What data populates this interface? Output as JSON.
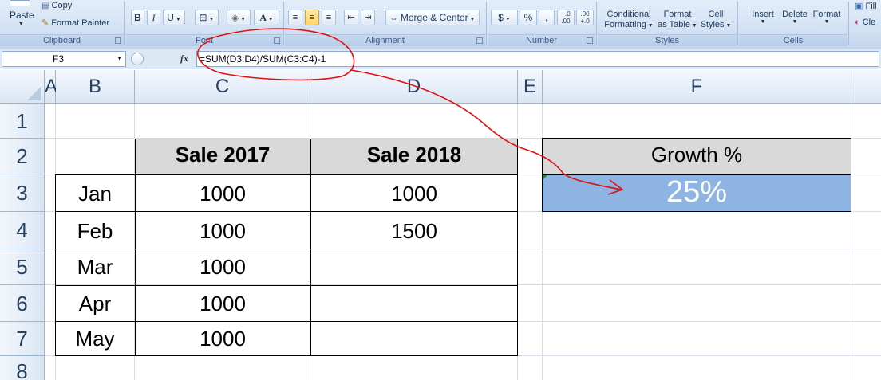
{
  "ribbon": {
    "clipboard": {
      "paste": "Paste",
      "copy": "Copy",
      "format_painter": "Format Painter",
      "label": "Clipboard"
    },
    "font": {
      "label": "Font",
      "bold": "B",
      "italic": "I",
      "underline": "U",
      "font_color": "A"
    },
    "alignment": {
      "label": "Alignment",
      "merge_center": "Merge & Center"
    },
    "number": {
      "label": "Number",
      "currency": "$",
      "percent": "%",
      "comma": ",",
      "inc_decimal": "+.0 .00",
      "dec_decimal": ".00 +.0"
    },
    "styles": {
      "label": "Styles",
      "conditional": "Conditional",
      "formatting": "Formatting",
      "format": "Format",
      "as_table": "as Table",
      "cell": "Cell",
      "styles": "Styles"
    },
    "cells": {
      "label": "Cells",
      "insert": "Insert",
      "delete": "Delete",
      "format": "Format"
    },
    "editing": {
      "fill": "Fill",
      "clear": "Cle"
    }
  },
  "formula_bar": {
    "name_box": "F3",
    "fx": "fx",
    "formula": "=SUM(D3:D4)/SUM(C3:C4)-1"
  },
  "columns": [
    "A",
    "B",
    "C",
    "D",
    "E",
    "F"
  ],
  "rows": [
    "1",
    "2",
    "3",
    "4",
    "5",
    "6",
    "7",
    "8"
  ],
  "table": {
    "header_c": "Sale 2017",
    "header_d": "Sale 2018",
    "months": [
      "Jan",
      "Feb",
      "Mar",
      "Apr",
      "May"
    ],
    "sale_2017": [
      "1000",
      "1000",
      "1000",
      "1000",
      "1000"
    ],
    "sale_2018": [
      "1000",
      "1500",
      "",
      "",
      ""
    ]
  },
  "growth": {
    "header": "Growth %",
    "value": "25%"
  },
  "colors": {
    "growth_fill": "#8db4e2",
    "header_fill": "#d9d9d9",
    "annotation": "#e01010"
  }
}
